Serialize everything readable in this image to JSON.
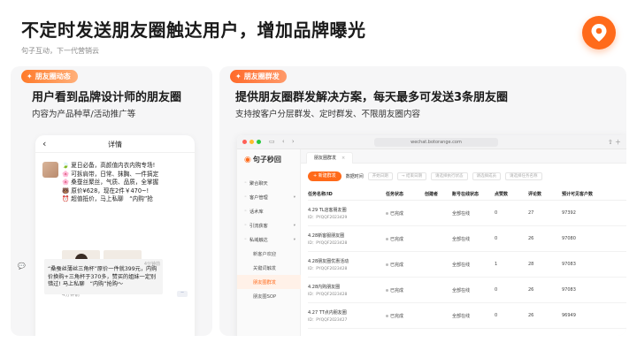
{
  "slide": {
    "title": "不定时发送朋友圈触达用户，增加品牌曝光",
    "subtitle": "句子互动，下一代营销云",
    "brand_color": "#ff6a1a"
  },
  "left_card": {
    "tag": "朋友圈动态",
    "heading": "用户看到品牌设计师的朋友圈",
    "description": "内容为产品种草/活动推广等",
    "phone": {
      "back_icon": "chevron-left-icon",
      "title": "详情",
      "post_lines": [
        "🍃 夏日必备，高颜值内衣内购专场!",
        "🌸 可拆肩带，日常、抹胸、一件搞定",
        "🌸 桑蚕丝聚丝，气质、品质，全掌握",
        "🐻 原价¥628，现在2件￥470~!",
        "⏰ 超值抵价，马上私聊　“内购”抢"
      ],
      "post_time": "4分钟前",
      "more": "··",
      "comment_time": "4分钟前",
      "comment_text": "“桑蚕丝薄丝三角杯”原价一件就399元，内购价换购+三角杯于370多，赞买的姐妹一定别错过! 马上私聊　“内购”抢购～"
    }
  },
  "right_card": {
    "tag": "朋友圈群发",
    "heading": "提供朋友圈群发解决方案，每天最多可发送3条朋友圈",
    "description": "支持按客户分层群发、定时群发、不限朋友圈内容",
    "browser": {
      "url": "wechat.botorange.com",
      "app_name": "句子秒回",
      "tab_label": "朋友圈群发",
      "tab_close": "×",
      "sidebar": [
        {
          "label": "聚合聊天",
          "icon": "chat-icon",
          "sub": false,
          "caret": false
        },
        {
          "label": "客户管理",
          "icon": "user-icon",
          "sub": false,
          "caret": true
        },
        {
          "label": "话术库",
          "icon": "book-icon",
          "sub": false,
          "caret": false
        },
        {
          "label": "引流获客",
          "icon": "flow-icon",
          "sub": false,
          "caret": true
        },
        {
          "label": "私域触达",
          "icon": "send-icon",
          "sub": false,
          "caret": true
        },
        {
          "label": "新客户欢迎",
          "sub": true
        },
        {
          "label": "关键词触发",
          "sub": true
        },
        {
          "label": "朋友圈群发",
          "sub": true,
          "active": true
        },
        {
          "label": "朋友圈SOP",
          "sub": true
        }
      ],
      "toolbar": {
        "new_button": "+ 新建群发",
        "filter_label": "数据时间",
        "filters": [
          "开始日期",
          "→ 结束日期",
          "请选择执行状态",
          "请选择成员",
          "请选择任务名称"
        ]
      },
      "columns": [
        "任务名称/ID",
        "任务状态",
        "创建者",
        "账号在线状态",
        "点赞数",
        "评论数",
        "预计可见客户数"
      ],
      "rows": [
        {
          "name": "4.29 TL店客朋友圈",
          "id": "ID：PYQQF2023429",
          "status": "已完成",
          "creator": "",
          "online": "全部在线",
          "likes": "0",
          "comments": "27",
          "reach": "97392"
        },
        {
          "name": "4.28新客服朋友圈",
          "id": "ID：PYQQF2023428",
          "status": "已完成",
          "creator": "",
          "online": "全部在线",
          "likes": "0",
          "comments": "26",
          "reach": "97080"
        },
        {
          "name": "4.28朋友圈优惠活动",
          "id": "ID：PYQQF2023428",
          "status": "已完成",
          "creator": "",
          "online": "全部在线",
          "likes": "1",
          "comments": "28",
          "reach": "97083"
        },
        {
          "name": "4.28内购朋友圈",
          "id": "ID：PYQQF2023428",
          "status": "已完成",
          "creator": "",
          "online": "全部在线",
          "likes": "0",
          "comments": "26",
          "reach": "97083"
        },
        {
          "name": "4.27 TT点内朋友圈",
          "id": "ID：PYQQF2023427",
          "status": "已完成",
          "creator": "",
          "online": "全部在线",
          "likes": "0",
          "comments": "26",
          "reach": "96949"
        }
      ]
    }
  }
}
